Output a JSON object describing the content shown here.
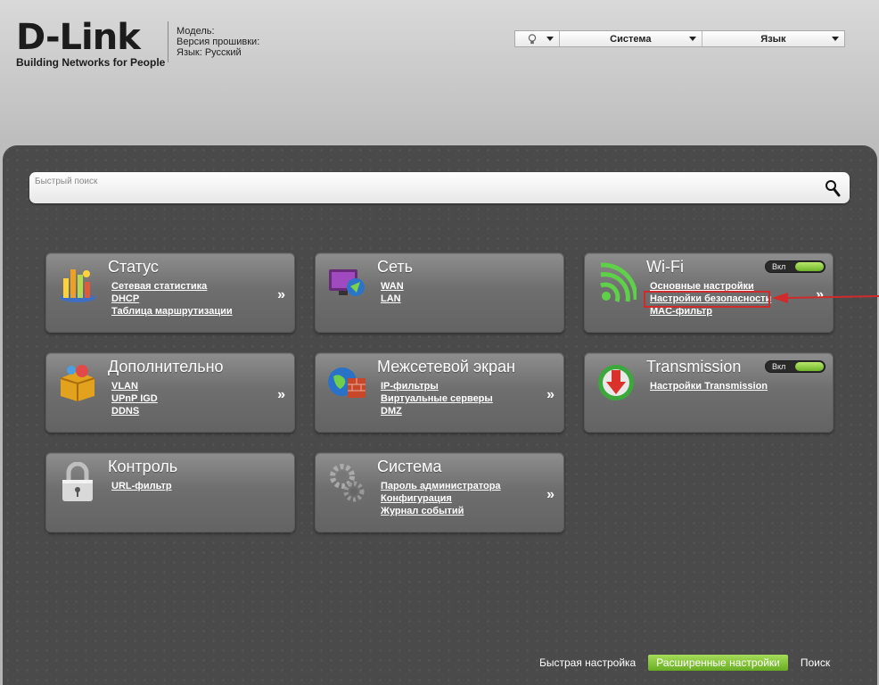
{
  "header": {
    "brand": "D-Link",
    "tagline": "Building Networks for People",
    "info": {
      "model": "Модель:",
      "firmware": "Версия прошивки:",
      "language": "Язык: Русский"
    },
    "topbar": {
      "system": "Система",
      "language": "Язык"
    }
  },
  "search": {
    "placeholder": "Быстрый поиск"
  },
  "tiles": {
    "status": {
      "title": "Статус",
      "links": [
        "Сетевая статистика",
        "DHCP",
        "Таблица маршрутизации"
      ]
    },
    "network": {
      "title": "Сеть",
      "links": [
        "WAN",
        "LAN"
      ]
    },
    "wifi": {
      "title": "Wi-Fi",
      "toggle": "Вкл",
      "links": [
        "Основные настройки",
        "Настройки безопасности",
        "MAC-фильтр"
      ]
    },
    "advanced": {
      "title": "Дополнительно",
      "links": [
        "VLAN",
        "UPnP IGD",
        "DDNS"
      ]
    },
    "firewall": {
      "title": "Межсетевой экран",
      "links": [
        "IP-фильтры",
        "Виртуальные серверы",
        "DMZ"
      ]
    },
    "transmission": {
      "title": "Transmission",
      "toggle": "Вкл",
      "links": [
        "Настройки Transmission"
      ]
    },
    "control": {
      "title": "Контроль",
      "links": [
        "URL-фильтр"
      ]
    },
    "system": {
      "title": "Система",
      "links": [
        "Пароль администратора",
        "Конфигурация",
        "Журнал событий"
      ]
    }
  },
  "more_glyph": "»",
  "bottom_nav": {
    "quick": "Быстрая настройка",
    "advanced": "Расширенные настройки",
    "search": "Поиск"
  },
  "colors": {
    "accent_green": "#7cc23a",
    "annotation_red": "#d02a2a"
  }
}
